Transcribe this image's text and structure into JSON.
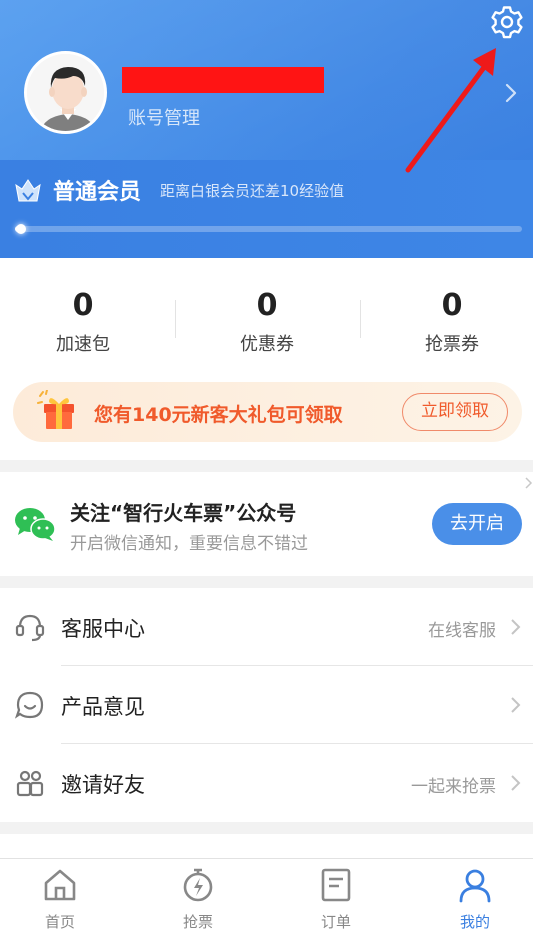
{
  "profile": {
    "account_label": "账号管理"
  },
  "membership": {
    "level": "普通会员",
    "tip": "距离白银会员还差10经验值",
    "progress": 0.02
  },
  "stats": [
    {
      "value": "0",
      "label": "加速包"
    },
    {
      "value": "0",
      "label": "优惠券"
    },
    {
      "value": "0",
      "label": "抢票券"
    }
  ],
  "promo": {
    "text": "您有140元新客大礼包可领取",
    "button": "立即领取"
  },
  "wechat": {
    "title": "关注“智行火车票”公众号",
    "subtitle": "开启微信通知，重要信息不错过",
    "button": "去开启"
  },
  "menu": [
    {
      "label": "客服中心",
      "aux": "在线客服",
      "icon": "headset-icon"
    },
    {
      "label": "产品意见",
      "aux": "",
      "icon": "feedback-icon"
    },
    {
      "label": "邀请好友",
      "aux": "一起来抢票",
      "icon": "friends-icon"
    }
  ],
  "tabs": [
    {
      "label": "首页",
      "icon": "home-icon",
      "active": false
    },
    {
      "label": "抢票",
      "icon": "stopwatch-icon",
      "active": false
    },
    {
      "label": "订单",
      "icon": "order-icon",
      "active": false
    },
    {
      "label": "我的",
      "icon": "profile-icon",
      "active": true
    }
  ],
  "colors": {
    "header_blue": "#3d85e4",
    "accent_orange": "#f05a2b",
    "active_tab": "#3a7fe0",
    "redaction": "#ff1414",
    "annotation_arrow": "#ee1a1a"
  }
}
